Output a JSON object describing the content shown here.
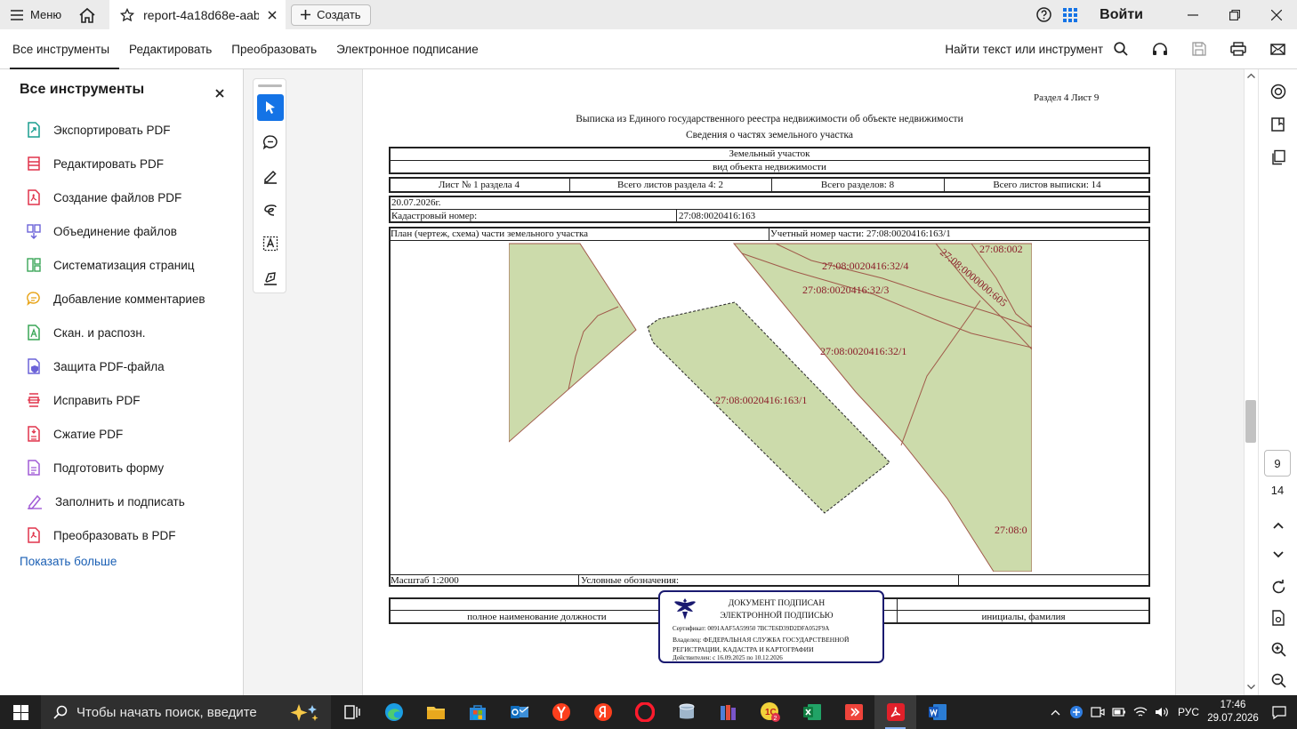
{
  "titlebar": {
    "menu_label": "Меню",
    "tab_label": "report-4a18d68e-aab...",
    "create_label": "Создать",
    "signin_label": "Войти"
  },
  "toolbar": {
    "tabs": [
      "Все инструменты",
      "Редактировать",
      "Преобразовать",
      "Электронное подписание"
    ],
    "find_label": "Найти текст или инструмент"
  },
  "sidebar": {
    "title": "Все инструменты",
    "items": [
      {
        "label": "Экспортировать PDF",
        "icon": "export-pdf-icon",
        "color": "#1a9e8f"
      },
      {
        "label": "Редактировать PDF",
        "icon": "edit-pdf-icon",
        "color": "#e0344b"
      },
      {
        "label": "Создание файлов PDF",
        "icon": "create-pdf-icon",
        "color": "#e0344b"
      },
      {
        "label": "Объединение файлов",
        "icon": "combine-files-icon",
        "color": "#6c63d8"
      },
      {
        "label": "Систематизация страниц",
        "icon": "organize-pages-icon",
        "color": "#3aa657"
      },
      {
        "label": "Добавление комментариев",
        "icon": "comment-icon",
        "color": "#e8a51b"
      },
      {
        "label": "Скан. и распозн.",
        "icon": "scan-ocr-icon",
        "color": "#3aa657"
      },
      {
        "label": "Защита PDF-файла",
        "icon": "protect-pdf-icon",
        "color": "#6c63d8"
      },
      {
        "label": "Исправить PDF",
        "icon": "redact-pdf-icon",
        "color": "#e0344b"
      },
      {
        "label": "Сжатие PDF",
        "icon": "compress-pdf-icon",
        "color": "#e0344b"
      },
      {
        "label": "Подготовить форму",
        "icon": "prepare-form-icon",
        "color": "#a15bd6"
      },
      {
        "label": "Заполнить и подписать",
        "icon": "fill-sign-icon",
        "color": "#a15bd6"
      },
      {
        "label": "Преобразовать в PDF",
        "icon": "convert-to-pdf-icon",
        "color": "#e0344b"
      }
    ],
    "show_more": "Показать больше"
  },
  "document": {
    "section_sheet": "Раздел 4   Лист 9",
    "title": "Выписка из Единого государственного реестра недвижимости об объекте недвижимости",
    "subtitle": "Сведения о частях земельного участка",
    "object_type": "Земельный участок",
    "object_caption": "вид объекта недвижимости",
    "sheet_no": "Лист № 1 раздела 4",
    "sheets_section": "Всего листов раздела 4: 2",
    "sections_total": "Всего разделов: 8",
    "sheets_total": "Всего листов выписки: 14",
    "date": "20.07.2026г.",
    "cadastral_label": "Кадастровый номер:",
    "cadastral_value": "27:08:0020416:163",
    "plan_label": "План (чертеж, схема) части земельного участка",
    "part_number": "Учетный номер части: 27:08:0020416:163/1",
    "map_labels": [
      "27:08:0020416:32/4",
      "27:08:0020416:32/3",
      "27:08:0020416:32/1",
      "27:08:0020416:163/1",
      "27:08:0000000:605",
      "27:08:002",
      "27:08:0"
    ],
    "scale": "Масштаб 1:2000",
    "legend": "Условные обозначения:",
    "position_caption": "полное наименование должности",
    "initials_caption": "инициалы, фамилия",
    "stamp": {
      "line1": "ДОКУМЕНТ ПОДПИСАН",
      "line2": "ЭЛЕКТРОННОЙ ПОДПИСЬЮ",
      "cert": "Сертификат: 0091AAF5A59950 7BC7E6D39D2DFA052F9A",
      "owner1": "Владелец: ФЕДЕРАЛЬНАЯ СЛУЖБА ГОСУДАРСТВЕННОЙ",
      "owner2": "РЕГИСТРАЦИИ, КАДАСТРА И КАРТОГРАФИИ",
      "valid": "Действителен: с 16.09.2025 по 10.12.2026"
    }
  },
  "pager": {
    "current": "9",
    "total": "14"
  },
  "taskbar": {
    "search_placeholder": "Чтобы начать поиск, введите",
    "lang": "РУС",
    "time": "17:46",
    "date": "29.07.2026"
  },
  "colors": {
    "parcel_fill": "#ccdbab",
    "parcel_border": "#a05a4a",
    "label_color": "#8b1e2a",
    "accent": "#1473e6",
    "stamp_border": "#1a1a70"
  }
}
